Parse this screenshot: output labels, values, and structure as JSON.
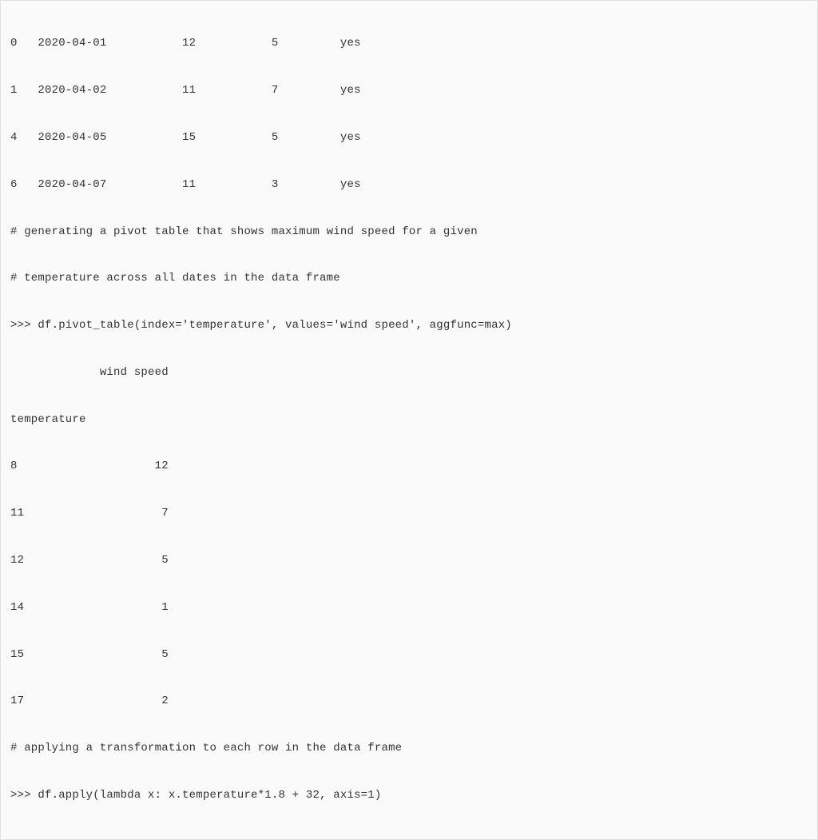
{
  "lines": [
    "0   2020-04-01           12           5         yes",
    "1   2020-04-02           11           7         yes",
    "4   2020-04-05           15           5         yes",
    "6   2020-04-07           11           3         yes",
    "# generating a pivot table that shows maximum wind speed for a given",
    "# temperature across all dates in the data frame",
    ">>> df.pivot_table(index='temperature', values='wind speed', aggfunc=max)",
    "             wind speed",
    "temperature",
    "8                    12",
    "11                    7",
    "12                    5",
    "14                    1",
    "15                    5",
    "17                    2",
    "# applying a transformation to each row in the data frame",
    ">>> df.apply(lambda x: x.temperature*1.8 + 32, axis=1)"
  ],
  "data_rows_1": [
    {
      "index": "0",
      "date": "2020-04-01",
      "col1": "12",
      "col2": "5",
      "col3": "yes"
    },
    {
      "index": "1",
      "date": "2020-04-02",
      "col1": "11",
      "col2": "7",
      "col3": "yes"
    },
    {
      "index": "4",
      "date": "2020-04-05",
      "col1": "15",
      "col2": "5",
      "col3": "yes"
    },
    {
      "index": "6",
      "date": "2020-04-07",
      "col1": "11",
      "col2": "3",
      "col3": "yes"
    }
  ],
  "comments": {
    "c1": "# generating a pivot table that shows maximum wind speed for a given",
    "c2": "# temperature across all dates in the data frame",
    "c3": "# applying a transformation to each row in the data frame"
  },
  "commands": {
    "cmd1": ">>> df.pivot_table(index='temperature', values='wind speed', aggfunc=max)",
    "cmd2": ">>> df.apply(lambda x: x.temperature*1.8 + 32, axis=1)"
  },
  "pivot_header": {
    "col": "             wind speed",
    "idx": "temperature"
  },
  "pivot_rows": [
    {
      "temp": "8",
      "wind": "12"
    },
    {
      "temp": "11",
      "wind": "7"
    },
    {
      "temp": "12",
      "wind": "5"
    },
    {
      "temp": "14",
      "wind": "1"
    },
    {
      "temp": "15",
      "wind": "5"
    },
    {
      "temp": "17",
      "wind": "2"
    }
  ]
}
